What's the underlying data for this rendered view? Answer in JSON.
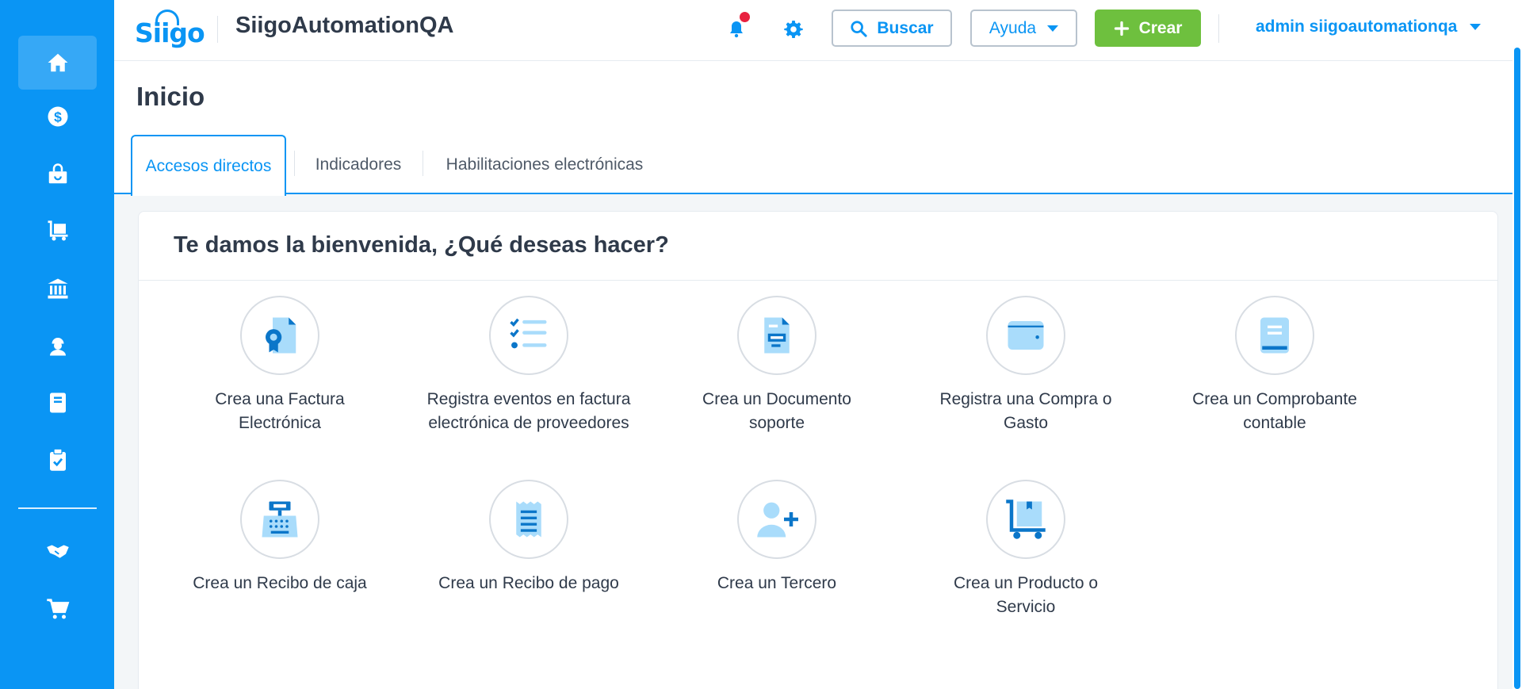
{
  "header": {
    "logo_text": "Siigo",
    "app_title": "SiigoAutomationQA",
    "search_label": "Buscar",
    "help_label": "Ayuda",
    "create_label": "Crear",
    "user_label": "admin siigoautomationqa"
  },
  "sidebar": {
    "items": [
      {
        "icon": "home-icon",
        "active": true
      },
      {
        "icon": "dollar-icon"
      },
      {
        "icon": "shopping-bag-icon"
      },
      {
        "icon": "cart-truck-icon"
      },
      {
        "icon": "bank-icon"
      },
      {
        "icon": "worker-icon"
      },
      {
        "icon": "book-icon"
      },
      {
        "icon": "clipboard-check-icon"
      },
      {
        "icon": "handshake-icon"
      },
      {
        "icon": "shopping-cart-icon"
      }
    ]
  },
  "page": {
    "title": "Inicio",
    "tabs": [
      "Accesos directos",
      "Indicadores",
      "Habilitaciones electrónicas"
    ],
    "active_tab": 0
  },
  "welcome": {
    "title": "Te damos la bienvenida, ¿Qué deseas hacer?"
  },
  "shortcuts": [
    {
      "line1": "Crea una Factura",
      "line2": "Electrónica",
      "icon": "invoice-ribbon-icon"
    },
    {
      "line1": "Registra eventos en factura",
      "line2": "electrónica de proveedores",
      "icon": "checklist-icon"
    },
    {
      "line1": "Crea un Documento",
      "line2": "soporte",
      "icon": "document-icon"
    },
    {
      "line1": "Registra una Compra o",
      "line2": "Gasto",
      "icon": "wallet-icon"
    },
    {
      "line1": "Crea un Comprobante",
      "line2": "contable",
      "icon": "ledger-icon"
    },
    {
      "line1": "Crea un Recibo de caja",
      "line2": "",
      "icon": "cash-register-icon"
    },
    {
      "line1": "Crea un Recibo de pago",
      "line2": "",
      "icon": "receipt-icon"
    },
    {
      "line1": "Crea un Tercero",
      "line2": "",
      "icon": "add-user-icon"
    },
    {
      "line1": "Crea un Producto o",
      "line2": "Servicio",
      "icon": "product-cart-icon"
    }
  ],
  "colors": {
    "primary": "#0a95f4",
    "create_green": "#6ec03e",
    "notification_red": "#e8213f",
    "icon_light": "#a9dcfb",
    "icon_dark": "#0b76c9"
  }
}
